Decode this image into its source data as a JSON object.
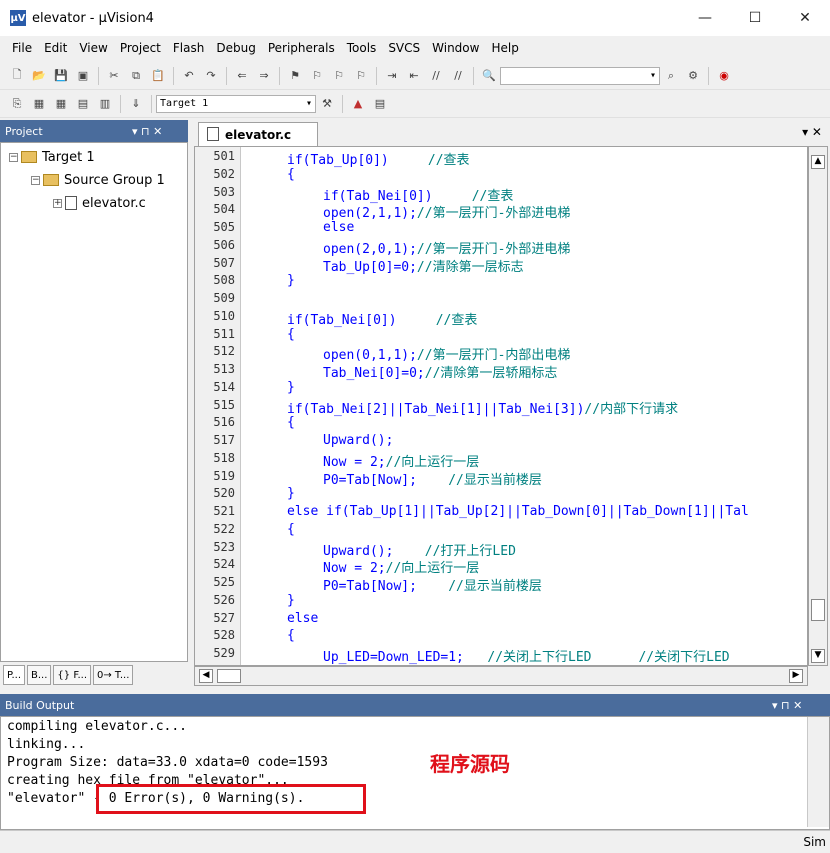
{
  "window": {
    "title": "elevator  - µVision4",
    "app_icon": "µV",
    "minimize": "—",
    "maximize": "☐",
    "close": "✕"
  },
  "menu": [
    "File",
    "Edit",
    "View",
    "Project",
    "Flash",
    "Debug",
    "Peripherals",
    "Tools",
    "SVCS",
    "Window",
    "Help"
  ],
  "toolbar": {
    "target_select": "Target 1"
  },
  "project_panel": {
    "title": "Project",
    "controls": "▾ ⊓ ✕",
    "tree": {
      "target": "Target 1",
      "group": "Source Group 1",
      "file": "elevator.c"
    },
    "tabs": [
      "P...",
      "B...",
      "{} F...",
      "0→ T..."
    ]
  },
  "editor": {
    "tab_label": "elevator.c",
    "tab_controls": "▾ ✕",
    "lines": [
      {
        "n": "501",
        "code": "if(Tab_Up[0])",
        "comment": "     //查表",
        "indent": 1
      },
      {
        "n": "502",
        "code": "{",
        "comment": "",
        "indent": 1
      },
      {
        "n": "503",
        "code": "if(Tab_Nei[0])",
        "comment": "     //查表",
        "indent": 2
      },
      {
        "n": "504",
        "code": "open(2,1,1);",
        "comment": "//第一层开门-外部进电梯",
        "indent": 2
      },
      {
        "n": "505",
        "code": "else",
        "comment": "",
        "indent": 2
      },
      {
        "n": "506",
        "code": "open(2,0,1);",
        "comment": "//第一层开门-外部进电梯",
        "indent": 2
      },
      {
        "n": "507",
        "code": "Tab_Up[0]=0;",
        "comment": "//清除第一层标志",
        "indent": 2
      },
      {
        "n": "508",
        "code": "}",
        "comment": "",
        "indent": 1
      },
      {
        "n": "509",
        "code": "",
        "comment": "",
        "indent": 1
      },
      {
        "n": "510",
        "code": "if(Tab_Nei[0])",
        "comment": "     //查表",
        "indent": 1
      },
      {
        "n": "511",
        "code": "{",
        "comment": "",
        "indent": 1
      },
      {
        "n": "512",
        "code": "open(0,1,1);",
        "comment": "//第一层开门-内部出电梯",
        "indent": 2
      },
      {
        "n": "513",
        "code": "Tab_Nei[0]=0;",
        "comment": "//清除第一层轿厢标志",
        "indent": 2
      },
      {
        "n": "514",
        "code": "}",
        "comment": "",
        "indent": 1
      },
      {
        "n": "515",
        "code": "if(Tab_Nei[2]||Tab_Nei[1]||Tab_Nei[3])",
        "comment": "//内部下行请求",
        "indent": 1
      },
      {
        "n": "516",
        "code": "{",
        "comment": "",
        "indent": 1
      },
      {
        "n": "517",
        "code": "Upward();",
        "comment": "",
        "indent": 2
      },
      {
        "n": "518",
        "code": "Now = 2;",
        "comment": "//向上运行一层",
        "indent": 2
      },
      {
        "n": "519",
        "code": "P0=Tab[Now];",
        "comment": "    //显示当前楼层",
        "indent": 2
      },
      {
        "n": "520",
        "code": "}",
        "comment": "",
        "indent": 1
      },
      {
        "n": "521",
        "code": "else if(Tab_Up[1]||Tab_Up[2]||Tab_Down[0]||Tab_Down[1]||Tal",
        "comment": "",
        "indent": 1
      },
      {
        "n": "522",
        "code": "{",
        "comment": "",
        "indent": 1
      },
      {
        "n": "523",
        "code": "Upward();",
        "comment": "    //打开上行LED",
        "indent": 2
      },
      {
        "n": "524",
        "code": "Now = 2;",
        "comment": "//向上运行一层",
        "indent": 2
      },
      {
        "n": "525",
        "code": "P0=Tab[Now];",
        "comment": "    //显示当前楼层",
        "indent": 2
      },
      {
        "n": "526",
        "code": "}",
        "comment": "",
        "indent": 1
      },
      {
        "n": "527",
        "code": "else",
        "comment": "",
        "indent": 1
      },
      {
        "n": "528",
        "code": "{",
        "comment": "",
        "indent": 1
      },
      {
        "n": "529",
        "code": "Up_LED=Down_LED=1;",
        "comment": "   //关闭上下行LED      //关闭下行LED",
        "indent": 2
      }
    ]
  },
  "build_output": {
    "title": "Build Output",
    "controls": "▾ ⊓ ✕",
    "lines": [
      "compiling elevator.c...",
      "linking...",
      "Program Size: data=33.0 xdata=0 code=1593",
      "creating hex file from \"elevator\"...",
      "\"elevator\" - 0 Error(s), 0 Warning(s)."
    ]
  },
  "annotation": "程序源码",
  "status": "Sim",
  "colors": {
    "highlight_red": "#e0101a",
    "keyword": "#0000ff",
    "comment": "#008080"
  }
}
